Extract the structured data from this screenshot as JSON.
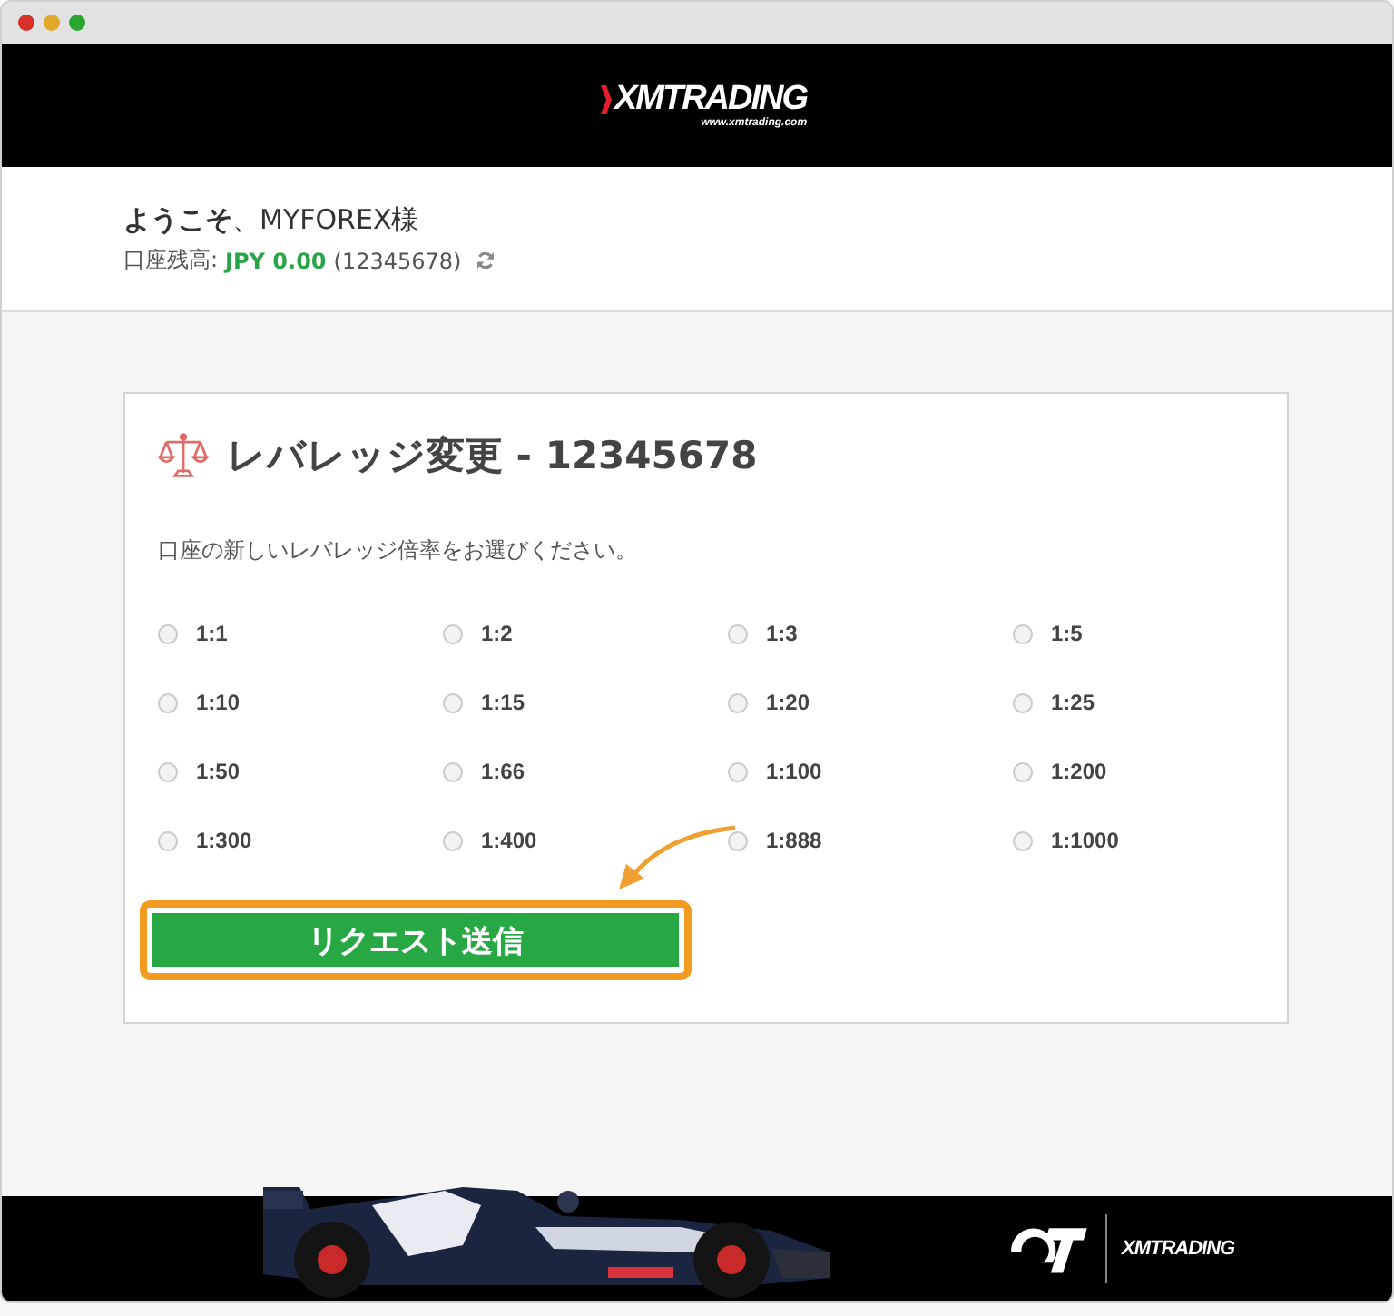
{
  "header": {
    "logo": "XMTRADING",
    "logo_url": "www.xmtrading.com"
  },
  "account": {
    "greeting": "**ようこそ**、MYFOREX様",
    "balance_label": "口座残高:",
    "balance": "JPY 0.00",
    "account_number": "(12345678)"
  },
  "card": {
    "title": "レバレッジ変更 - 12345678",
    "instruction": "口座の新しいレバレッジ倍率をお選びください。",
    "options": [
      {
        "label": "1:1",
        "selected": false
      },
      {
        "label": "1:2",
        "selected": false
      },
      {
        "label": "1:3",
        "selected": false
      },
      {
        "label": "1:5",
        "selected": false
      },
      {
        "label": "1:10",
        "selected": false
      },
      {
        "label": "1:15",
        "selected": false
      },
      {
        "label": "1:20",
        "selected": false
      },
      {
        "label": "1:25",
        "selected": false
      },
      {
        "label": "1:50",
        "selected": false
      },
      {
        "label": "1:66",
        "selected": false
      },
      {
        "label": "1:100",
        "selected": false
      },
      {
        "label": "1:200",
        "selected": false
      },
      {
        "label": "1:300",
        "selected": false
      },
      {
        "label": "1:400",
        "selected": false
      },
      {
        "label": "1:888",
        "selected": false
      },
      {
        "label": "1:1000",
        "selected": false
      }
    ],
    "submit": {
      "label": "リクエスト送信",
      "highlighted": true
    }
  },
  "footer": {
    "logo": "XMTRADING"
  }
}
